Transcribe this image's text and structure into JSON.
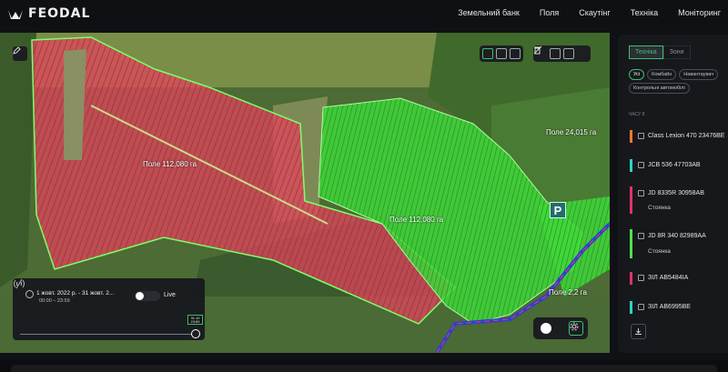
{
  "app": {
    "logo_text": "FEODAL"
  },
  "nav": {
    "items": [
      "Земельний банк",
      "Поля",
      "Скаутінг",
      "Техніка",
      "Моніторинг"
    ]
  },
  "map": {
    "fields": [
      {
        "label": "Поле 112,080 га"
      },
      {
        "label": "Поле 112,080 га"
      },
      {
        "label": "Поле 24,015 га"
      },
      {
        "label": "Поле 2,2 га"
      }
    ],
    "parking_label": "P"
  },
  "timeline": {
    "date_range": "1 жовт. 2022 р. - 31 жовт. 2...",
    "time_range": "00:00 – 23:59",
    "live_label": "Live",
    "marker_top": "31.10",
    "marker_bottom": "23:59"
  },
  "panel": {
    "tabs": [
      "Техніка",
      "Зони"
    ],
    "active_tab": "Техніка",
    "chips": [
      "Усі",
      "Комбайн",
      "Навантаувач",
      "Контрольні автомобілі"
    ],
    "section_label": "ЧАСУ 8",
    "vehicles": [
      {
        "name": "Class Lexion 470 23476BE",
        "status": "",
        "color": "#f07a2a"
      },
      {
        "name": "JCB 536 47703AB",
        "status": "",
        "color": "#2ed3c7"
      },
      {
        "name": "JD 8335R 30958AB",
        "status": "Стоянка",
        "color": "#e0336a"
      },
      {
        "name": "JD 8R 340 82989AA",
        "status": "Стоянка",
        "color": "#4fe04a"
      },
      {
        "name": "ЗІЛ АВ5484ІА",
        "status": "",
        "color": "#e0336a"
      },
      {
        "name": "ЗІЛ АВ6995ВЕ",
        "status": "",
        "color": "#2ed3c7"
      }
    ]
  }
}
